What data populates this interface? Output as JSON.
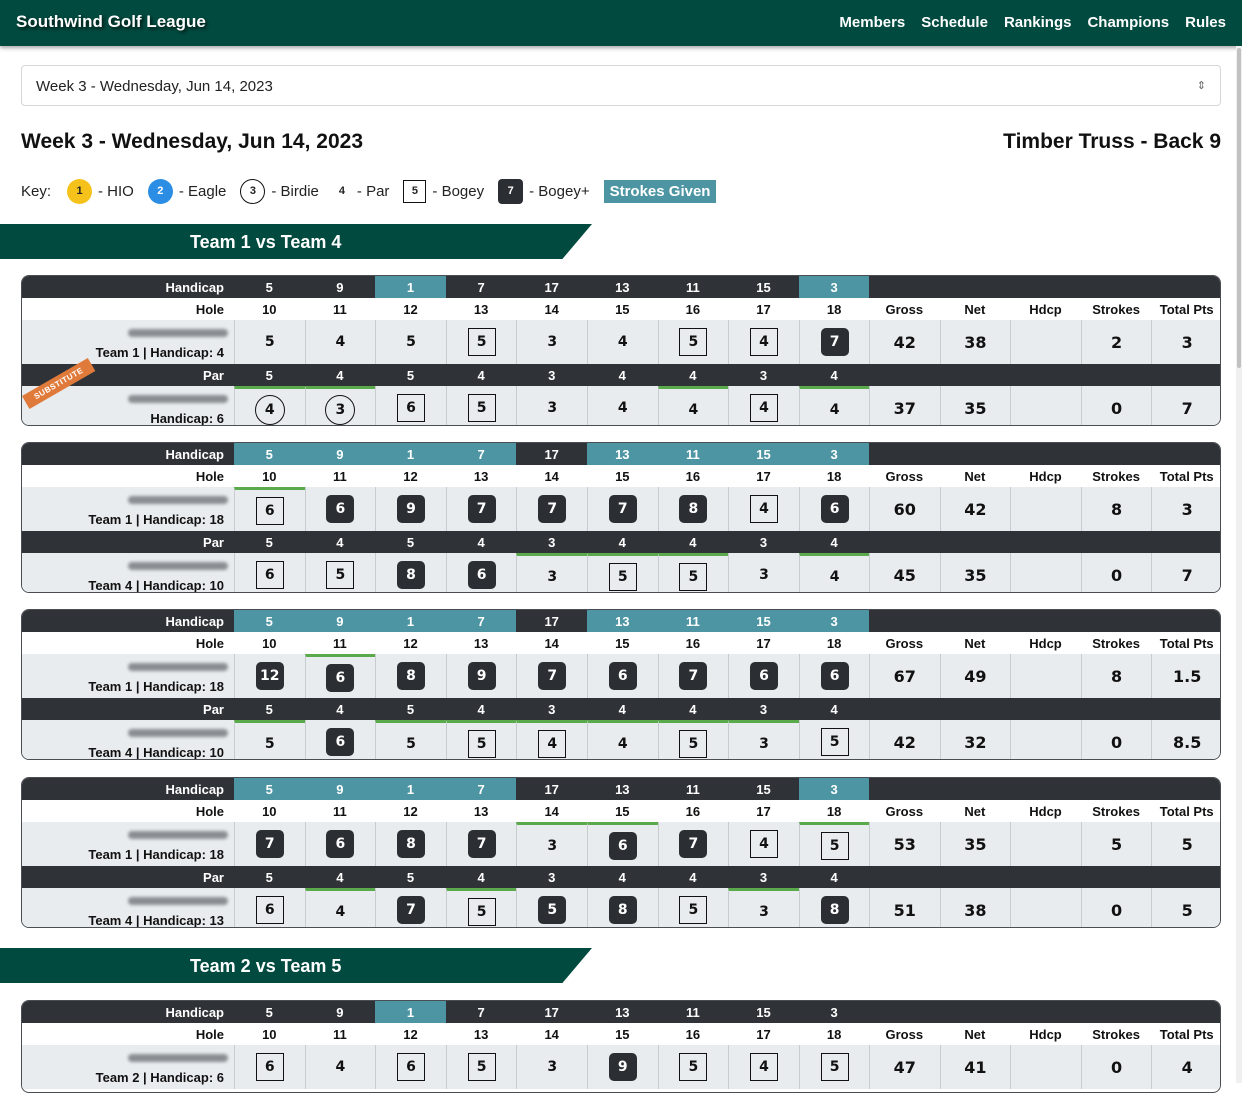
{
  "nav": {
    "brand": "Southwind Golf League",
    "links": [
      "Members",
      "Schedule",
      "Rankings",
      "Champions",
      "Rules"
    ]
  },
  "week_select": {
    "value": "Week 3 - Wednesday, Jun 14, 2023"
  },
  "page_title": "Week 3 - Wednesday, Jun 14, 2023",
  "course_title": "Timber Truss - Back 9",
  "key": {
    "intro": "Key:",
    "items": [
      {
        "sym": "1",
        "label": "- HIO",
        "type": "hio"
      },
      {
        "sym": "2",
        "label": "- Eagle",
        "type": "eagle"
      },
      {
        "sym": "3",
        "label": "- Birdie",
        "type": "birdie"
      },
      {
        "sym": "4",
        "label": "- Par",
        "type": "par"
      },
      {
        "sym": "5",
        "label": "- Bogey",
        "type": "bogey"
      },
      {
        "sym": "7",
        "label": "- Bogey+",
        "type": "plus"
      }
    ],
    "strokes_given": "Strokes Given"
  },
  "labels": {
    "handicap": "Handicap",
    "hole": "Hole",
    "par": "Par",
    "gross": "Gross",
    "net": "Net",
    "hdcp": "Hdcp",
    "strokes": "Strokes",
    "total": "Total Pts",
    "substitute": "SUBSTITUTE"
  },
  "holes": [
    "10",
    "11",
    "12",
    "13",
    "14",
    "15",
    "16",
    "17",
    "18"
  ],
  "handicaps": [
    "5",
    "9",
    "1",
    "7",
    "17",
    "13",
    "11",
    "15",
    "3"
  ],
  "pars": [
    "5",
    "4",
    "5",
    "4",
    "3",
    "4",
    "4",
    "3",
    "4"
  ],
  "matchups": [
    {
      "title": "Team 1 vs Team 4",
      "cards": [
        {
          "hcp_highlight": [
            2,
            8
          ],
          "p1": {
            "team": "Team 1 | Handicap: 4",
            "scores": [
              "5",
              "4",
              "5",
              "5",
              "3",
              "4",
              "5",
              "4",
              "7"
            ],
            "types": [
              "n",
              "n",
              "n",
              "b",
              "n",
              "n",
              "b",
              "b",
              "p"
            ],
            "strokes": [],
            "gross": "42",
            "net": "38",
            "hdcp": "",
            "str": "2",
            "total": "3"
          },
          "p2": {
            "team": "Handicap: 6",
            "sub": true,
            "scores": [
              "4",
              "3",
              "6",
              "5",
              "3",
              "4",
              "4",
              "4",
              "4"
            ],
            "types": [
              "r",
              "r",
              "b",
              "b",
              "n",
              "n",
              "n",
              "b",
              "n"
            ],
            "strokes": [
              0,
              1,
              6,
              8
            ],
            "gross": "37",
            "net": "35",
            "hdcp": "",
            "str": "0",
            "total": "7"
          }
        },
        {
          "hcp_highlight": [
            0,
            1,
            2,
            3,
            5,
            6,
            7,
            8
          ],
          "p1": {
            "team": "Team 1 | Handicap: 18",
            "scores": [
              "6",
              "6",
              "9",
              "7",
              "7",
              "7",
              "8",
              "4",
              "6"
            ],
            "types": [
              "b",
              "p",
              "p",
              "p",
              "p",
              "p",
              "p",
              "b",
              "p"
            ],
            "strokes": [
              0
            ],
            "gross": "60",
            "net": "42",
            "hdcp": "",
            "str": "8",
            "total": "3"
          },
          "p2": {
            "team": "Team 4 | Handicap: 10",
            "scores": [
              "6",
              "5",
              "8",
              "6",
              "3",
              "5",
              "5",
              "3",
              "4"
            ],
            "types": [
              "b",
              "b",
              "p",
              "p",
              "n",
              "b",
              "b",
              "n",
              "n"
            ],
            "strokes": [
              4,
              5,
              6,
              8
            ],
            "gross": "45",
            "net": "35",
            "hdcp": "",
            "str": "0",
            "total": "7"
          }
        },
        {
          "hcp_highlight": [
            0,
            1,
            2,
            3,
            5,
            6,
            7,
            8
          ],
          "p1": {
            "team": "Team 1 | Handicap: 18",
            "scores": [
              "12",
              "6",
              "8",
              "9",
              "7",
              "6",
              "7",
              "6",
              "6"
            ],
            "types": [
              "p",
              "p",
              "p",
              "p",
              "p",
              "p",
              "p",
              "p",
              "p"
            ],
            "strokes": [
              1
            ],
            "gross": "67",
            "net": "49",
            "hdcp": "",
            "str": "8",
            "total": "1.5"
          },
          "p2": {
            "team": "Team 4 | Handicap: 10",
            "scores": [
              "5",
              "6",
              "5",
              "5",
              "4",
              "4",
              "5",
              "3",
              "5"
            ],
            "types": [
              "n",
              "p",
              "n",
              "b",
              "b",
              "n",
              "b",
              "n",
              "b"
            ],
            "strokes": [
              0,
              2,
              3,
              4,
              5,
              6,
              7
            ],
            "gross": "42",
            "net": "32",
            "hdcp": "",
            "str": "0",
            "total": "8.5"
          }
        },
        {
          "hcp_highlight": [
            0,
            1,
            2,
            3,
            8
          ],
          "p1": {
            "team": "Team 1 | Handicap: 18",
            "scores": [
              "7",
              "6",
              "8",
              "7",
              "3",
              "6",
              "7",
              "4",
              "5"
            ],
            "types": [
              "p",
              "p",
              "p",
              "p",
              "n",
              "p",
              "p",
              "b",
              "b"
            ],
            "strokes": [
              4,
              5,
              8
            ],
            "gross": "53",
            "net": "35",
            "hdcp": "",
            "str": "5",
            "total": "5"
          },
          "p2": {
            "team": "Team 4 | Handicap: 13",
            "scores": [
              "6",
              "4",
              "7",
              "5",
              "5",
              "8",
              "5",
              "3",
              "8"
            ],
            "types": [
              "b",
              "n",
              "p",
              "b",
              "p",
              "p",
              "b",
              "n",
              "p"
            ],
            "strokes": [
              1,
              3,
              7
            ],
            "gross": "51",
            "net": "38",
            "hdcp": "",
            "str": "0",
            "total": "5"
          }
        }
      ]
    },
    {
      "title": "Team 2 vs Team 5",
      "cards": [
        {
          "hcp_highlight": [
            2
          ],
          "p1": {
            "team": "Team 2 | Handicap: 6",
            "scores": [
              "6",
              "4",
              "6",
              "5",
              "3",
              "9",
              "5",
              "4",
              "5"
            ],
            "types": [
              "b",
              "n",
              "b",
              "b",
              "n",
              "p",
              "b",
              "b",
              "b"
            ],
            "strokes": [],
            "gross": "47",
            "net": "41",
            "hdcp": "",
            "str": "0",
            "total": "4"
          },
          "p2": null
        }
      ]
    }
  ]
}
